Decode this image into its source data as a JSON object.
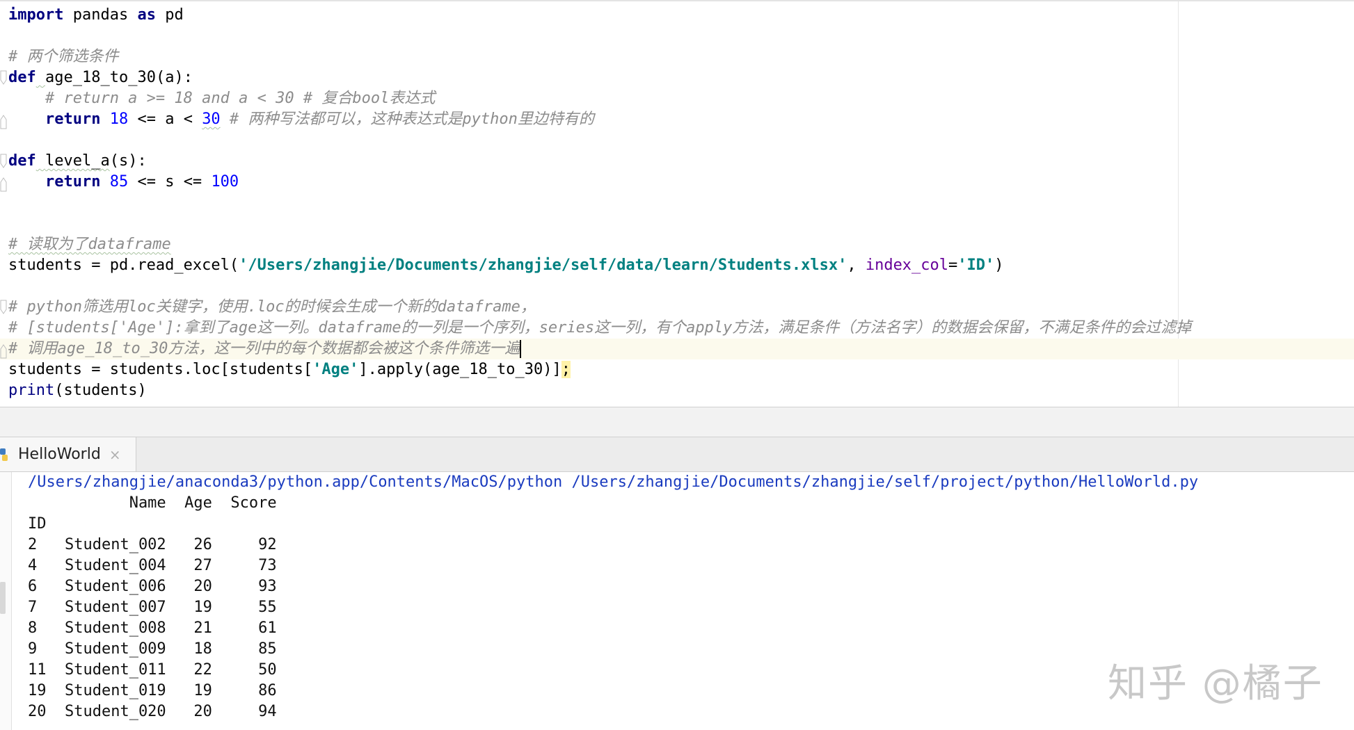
{
  "code": {
    "l1": {
      "kw1": "import",
      "mid": " pandas ",
      "kw2": "as",
      "end": " pd"
    },
    "l3": "# 两个筛选条件",
    "l4": {
      "kw": "def",
      "sp": " ",
      "name": "age_18_to_30",
      "rest": "(a):"
    },
    "l5": "    # return a >= 18 and a < 30 # 复合bool表达式",
    "l6": {
      "indent": "    ",
      "kw": "return",
      "sp": " ",
      "n1": "18",
      "mid": " <= a < ",
      "n2": "30",
      "cmt": " # 两种写法都可以，这种表达式是python里边特有的"
    },
    "l8": {
      "kw": "def",
      "sp": " ",
      "name": "level_a",
      "rest": "(s):"
    },
    "l9": {
      "indent": "    ",
      "kw": "return",
      "sp": " ",
      "n1": "85",
      "mid": " <= s <= ",
      "n2": "100"
    },
    "l12": "# 读取为了dataframe",
    "l13": {
      "pre": "students = pd.read_excel(",
      "path": "'/Users/zhangjie/Documents/zhangjie/self/data/learn/Students.xlsx'",
      "comma": ", ",
      "param": "index_col",
      "eq": "=",
      "val": "'ID'",
      "close": ")"
    },
    "l15": "# python筛选用loc关键字，使用.loc的时候会生成一个新的dataframe，",
    "l16": "# [students['Age']:拿到了age这一列。dataframe的一列是一个序列，series这一列，有个apply方法，满足条件（方法名字）的数据会保留，不满足条件的会过滤掉",
    "l17": "# 调用age_18_to_30方法，这一列中的每个数据都会被这个条件筛选一遍",
    "l18": {
      "pre": "students = students.loc[students[",
      "str": "'Age'",
      "post": "].apply(age_18_to_30)]",
      "semi": ";"
    },
    "l19": {
      "fn": "print",
      "rest": "(students)"
    }
  },
  "run_tab": {
    "label": "HelloWorld",
    "close": "×"
  },
  "console": {
    "command": "/Users/zhangjie/anaconda3/python.app/Contents/MacOS/python /Users/zhangjie/Documents/zhangjie/self/project/python/HelloWorld.py",
    "header": "           Name  Age  Score",
    "index_name": "ID",
    "rows": [
      {
        "id": "2",
        "name": "Student_002",
        "age": "26",
        "score": "92"
      },
      {
        "id": "4",
        "name": "Student_004",
        "age": "27",
        "score": "73"
      },
      {
        "id": "6",
        "name": "Student_006",
        "age": "20",
        "score": "93"
      },
      {
        "id": "7",
        "name": "Student_007",
        "age": "19",
        "score": "55"
      },
      {
        "id": "8",
        "name": "Student_008",
        "age": "21",
        "score": "61"
      },
      {
        "id": "9",
        "name": "Student_009",
        "age": "18",
        "score": "85"
      },
      {
        "id": "11",
        "name": "Student_011",
        "age": "22",
        "score": "50"
      },
      {
        "id": "19",
        "name": "Student_019",
        "age": "19",
        "score": "86"
      },
      {
        "id": "20",
        "name": "Student_020",
        "age": "20",
        "score": "94"
      }
    ]
  },
  "watermark": "知乎 @橘子"
}
